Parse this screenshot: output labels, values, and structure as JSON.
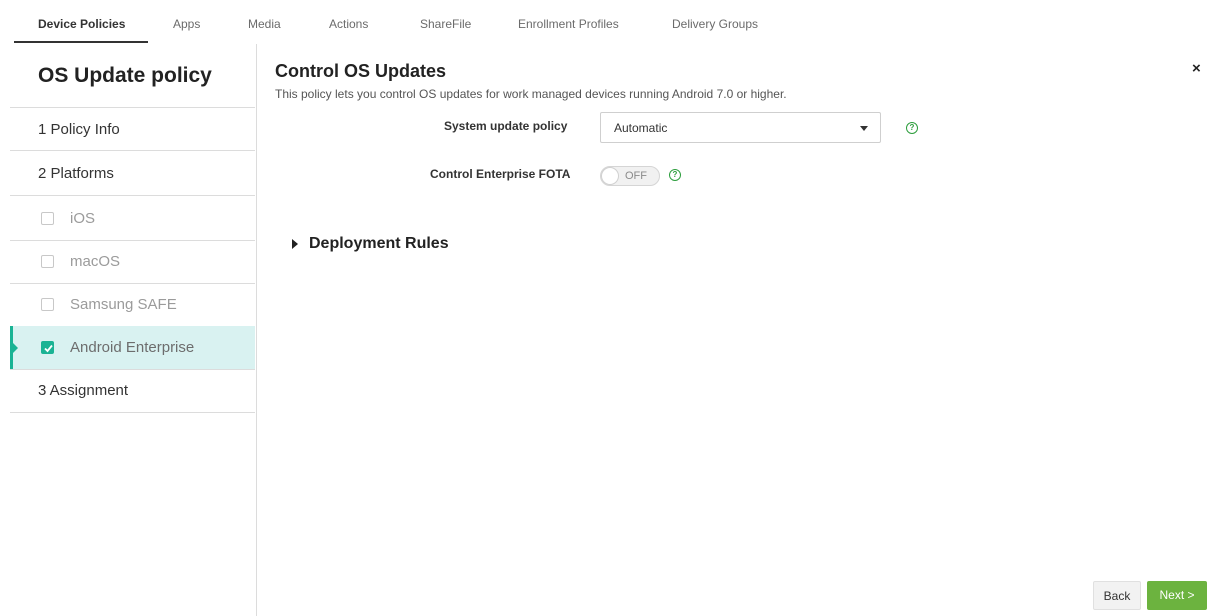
{
  "top_tabs": [
    "Device Policies",
    "Apps",
    "Media",
    "Actions",
    "ShareFile",
    "Enrollment Profiles",
    "Delivery Groups"
  ],
  "sidebar": {
    "title": "OS Update policy",
    "items": [
      {
        "label": "1 Policy Info"
      },
      {
        "label": "2 Platforms"
      },
      {
        "label": "iOS",
        "checked": false
      },
      {
        "label": "macOS",
        "checked": false
      },
      {
        "label": "Samsung SAFE",
        "checked": false
      },
      {
        "label": "Android Enterprise",
        "checked": true
      },
      {
        "label": "3 Assignment"
      }
    ]
  },
  "main": {
    "title": "Control OS Updates",
    "description": "This policy lets you control OS updates for work managed devices running Android 7.0 or higher.",
    "system_update_policy": {
      "label": "System update policy",
      "value": "Automatic"
    },
    "control_fota": {
      "label": "Control Enterprise FOTA",
      "state": "OFF"
    },
    "deployment_rules": "Deployment Rules"
  },
  "help_glyph": "?",
  "close_glyph": "×",
  "buttons": {
    "back": "Back",
    "next": "Next >"
  },
  "colors": {
    "accent": "#1ab394",
    "next_button": "#6cb33f",
    "help": "#2e9e3e",
    "selected_row": "#d9f2f1"
  }
}
